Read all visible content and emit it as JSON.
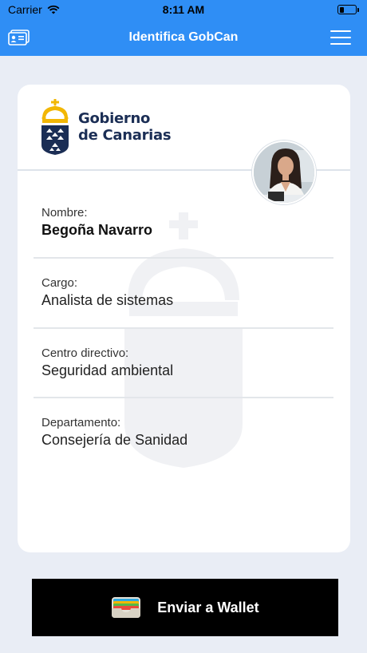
{
  "status_bar": {
    "carrier": "Carrier",
    "time": "8:11 AM"
  },
  "nav": {
    "title": "Identifica GobCan",
    "left_icon": "id-card-icon",
    "right_icon": "hamburger-menu-icon"
  },
  "card": {
    "logo_line1": "Gobierno",
    "logo_line2": "de Canarias",
    "fields": [
      {
        "label": "Nombre:",
        "value": "Begoña Navarro"
      },
      {
        "label": "Cargo:",
        "value": "Analista de sistemas"
      },
      {
        "label": "Centro directivo:",
        "value": "Seguridad ambiental"
      },
      {
        "label": "Departamento:",
        "value": "Consejería de Sanidad"
      }
    ]
  },
  "wallet_button": {
    "label": "Enviar a Wallet",
    "icon": "wallet-icon"
  },
  "colors": {
    "accent": "#2f8ef5",
    "background": "#e9edf5",
    "logo_navy": "#1b2e55",
    "logo_gold": "#f2b705"
  }
}
